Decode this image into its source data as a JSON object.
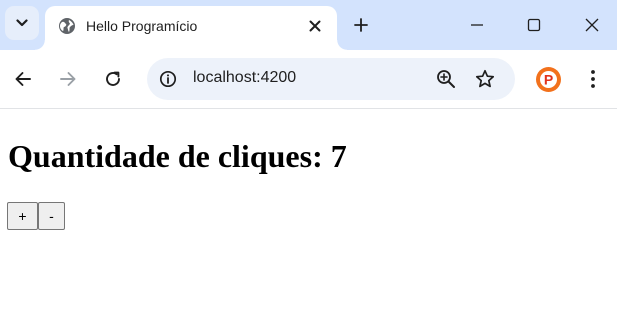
{
  "browser": {
    "tab": {
      "title": "Hello Programício"
    },
    "address_bar": {
      "url": "localhost:4200"
    },
    "profile_initial": "P"
  },
  "page": {
    "heading_label": "Quantidade de cliques:",
    "click_count": 7,
    "buttons": {
      "increment_label": "+",
      "decrement_label": "-"
    }
  },
  "icons": {
    "tab_search": "chevron-down-icon",
    "favicon": "globe-icon",
    "tab_close": "close-icon",
    "new_tab": "plus-icon",
    "minimize": "minimize-icon",
    "maximize": "maximize-icon",
    "close_window": "close-icon",
    "back": "arrow-left-icon",
    "forward": "arrow-right-icon",
    "reload": "reload-icon",
    "site_info": "info-icon",
    "zoom": "zoom-in-icon",
    "bookmark": "star-icon",
    "menu": "kebab-menu-icon"
  },
  "colors": {
    "tab_strip": "#d3e3fd",
    "omnibox": "#edf2fa",
    "profile": "#f2711c"
  }
}
